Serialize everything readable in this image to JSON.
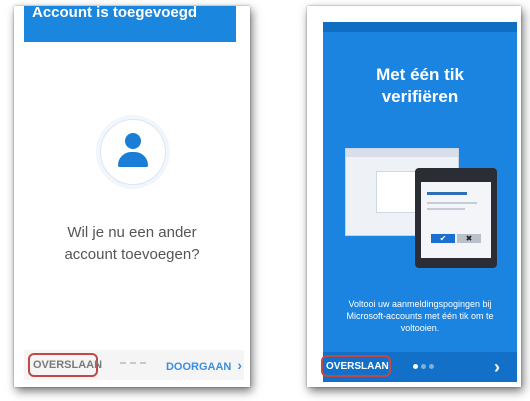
{
  "left_screen": {
    "header_title": "Account is toegevoegd",
    "question_line1": "Wil je nu een ander",
    "question_line2": "account toevoegen?",
    "skip_label": "OVERSLAAN",
    "next_label": "DOORGAAN",
    "next_icon": "chevron-right-icon",
    "avatar_icon": "user-icon"
  },
  "right_screen": {
    "title_line1": "Met één tik",
    "title_line2": "verifiëren",
    "desc_line1": "Voltooi uw aanmeldingspogingen bij",
    "desc_line2": "Microsoft-accounts met één tik om te",
    "desc_line3": "voltooien.",
    "skip_label": "OVERSLAAN",
    "next_icon": "chevron-right-icon",
    "next_glyph": "›",
    "approve_glyph": "✔",
    "deny_glyph": "✖",
    "page_indicator": {
      "total": 3,
      "active": 1
    }
  },
  "colors": {
    "accent_blue": "#1b84e0",
    "footer_blue": "#1270c8",
    "highlight_red": "#c24848"
  }
}
